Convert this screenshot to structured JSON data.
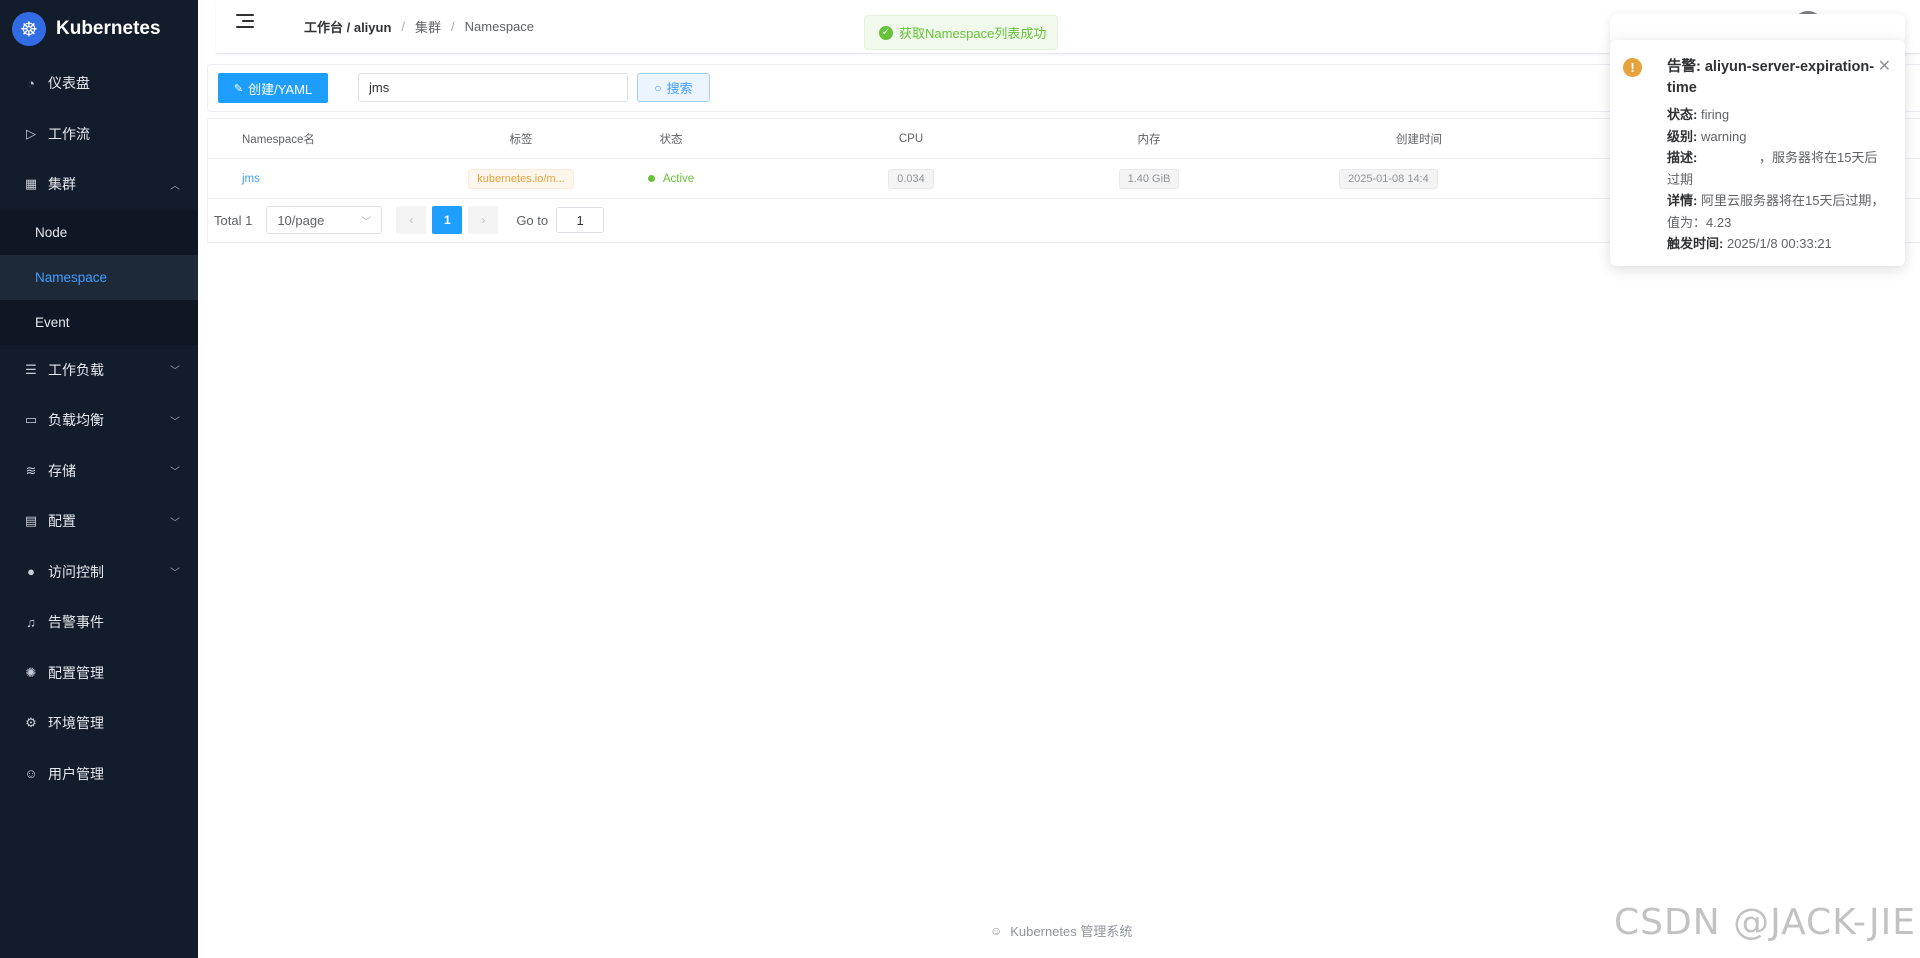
{
  "brand": {
    "title": "Kubernetes",
    "logo_icon": "helm-wheel-icon"
  },
  "sidebar": {
    "items": [
      {
        "label": "仪表盘",
        "icon": "dashboard-icon"
      },
      {
        "label": "工作流",
        "icon": "play-circle-icon"
      },
      {
        "label": "集群",
        "icon": "grid-icon",
        "expanded": true,
        "children": [
          {
            "label": "Node"
          },
          {
            "label": "Namespace",
            "active": true
          },
          {
            "label": "Event"
          }
        ]
      },
      {
        "label": "工作负载",
        "icon": "sliders-icon"
      },
      {
        "label": "负载均衡",
        "icon": "briefcase-icon"
      },
      {
        "label": "存储",
        "icon": "database-icon"
      },
      {
        "label": "配置",
        "icon": "document-icon"
      },
      {
        "label": "访问控制",
        "icon": "user-filled-icon"
      },
      {
        "label": "告警事件",
        "icon": "bell-icon"
      },
      {
        "label": "配置管理",
        "icon": "cog-circle-icon"
      },
      {
        "label": "环境管理",
        "icon": "gear-icon"
      },
      {
        "label": "用户管理",
        "icon": "user-icon"
      }
    ]
  },
  "header": {
    "breadcrumb": {
      "home": "工作台 / aliyun",
      "sep": "/",
      "level1": "集群",
      "level2": "Namespace"
    }
  },
  "toast": {
    "text": "获取Namespace列表成功",
    "color": "#67c23a"
  },
  "toolbar": {
    "create_label": "创建/YAML",
    "search_value": "jms",
    "search_label": "搜索"
  },
  "table": {
    "headers": {
      "name": "Namespace名",
      "labels": "标签",
      "status": "状态",
      "cpu": "CPU",
      "memory": "内存",
      "created": "创建时间"
    },
    "rows": [
      {
        "name": "jms",
        "label": "kubernetes.io/m...",
        "status": "Active",
        "cpu": "0.034",
        "memory": "1.40 GiB",
        "created": "2025-01-08 14:4"
      }
    ]
  },
  "pagination": {
    "total": "Total 1",
    "page_size": "10/page",
    "current": "1",
    "goto_label": "Go to",
    "goto_value": "1"
  },
  "notification": {
    "title": "告警: aliyun-server-expiration-time",
    "status_label": "状态:",
    "status_value": "firing",
    "level_label": "级别:",
    "level_value": "warning",
    "desc_label": "描述:",
    "desc_value": "，服务器将在15天后过期",
    "detail_label": "详情:",
    "detail_value": "阿里云服务器将在15天后过期，值为：4.23",
    "time_label": "触发时间:",
    "time_value": "2025/1/8 00:33:21",
    "accent": "#e6a23c"
  },
  "footer": {
    "text": "Kubernetes 管理系统"
  },
  "watermark": "CSDN @JACK-JIE"
}
